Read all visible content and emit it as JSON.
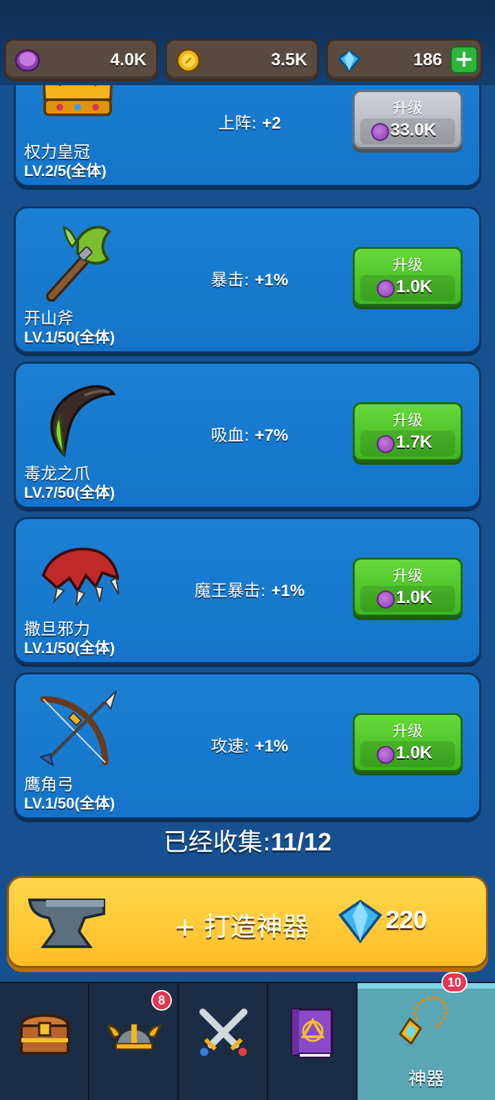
{
  "resources": [
    {
      "icon": "purple-coin-icon",
      "value": "4.0K"
    },
    {
      "icon": "gold-coin-icon",
      "value": "3.5K"
    },
    {
      "icon": "diamond-icon",
      "value": "186"
    }
  ],
  "resources_add_label": "+",
  "artifacts": [
    {
      "name": "权力皇冠",
      "level": "LV.2/5(全体)",
      "stat_label": "上阵: ",
      "stat_value": "+2",
      "button_label": "升级",
      "cost": "33.0K",
      "maxed": true,
      "icon": "crown-icon"
    },
    {
      "name": "开山斧",
      "level": "LV.1/50(全体)",
      "stat_label": "暴击: ",
      "stat_value": "+1%",
      "button_label": "升级",
      "cost": "1.0K",
      "maxed": false,
      "icon": "axe-icon"
    },
    {
      "name": "毒龙之爪",
      "level": "LV.7/50(全体)",
      "stat_label": "吸血: ",
      "stat_value": "+7%",
      "button_label": "升级",
      "cost": "1.7K",
      "maxed": false,
      "icon": "claw-icon"
    },
    {
      "name": "撒旦邪力",
      "level": "LV.1/50(全体)",
      "stat_label": "魔王暴击: ",
      "stat_value": "+1%",
      "button_label": "升级",
      "cost": "1.0K",
      "maxed": false,
      "icon": "demon-claw-icon"
    },
    {
      "name": "鹰角弓",
      "level": "LV.1/50(全体)",
      "stat_label": "攻速: ",
      "stat_value": "+1%",
      "button_label": "升级",
      "cost": "1.0K",
      "maxed": false,
      "icon": "bow-icon"
    }
  ],
  "collected": {
    "label": "已经收集:",
    "value": "11/12"
  },
  "forge": {
    "label": "+ 打造神器",
    "price": "220",
    "icon": "anvil-icon",
    "price_icon": "diamond-icon"
  },
  "tabs": [
    {
      "icon": "treasure-chest-icon",
      "label": "",
      "badge": ""
    },
    {
      "icon": "viking-helmet-icon",
      "label": "",
      "badge": "8"
    },
    {
      "icon": "crossed-swords-icon",
      "label": "",
      "badge": ""
    },
    {
      "icon": "spell-book-icon",
      "label": "",
      "badge": ""
    },
    {
      "icon": "amulet-icon",
      "label": "神器",
      "badge": "10",
      "active": true
    }
  ]
}
